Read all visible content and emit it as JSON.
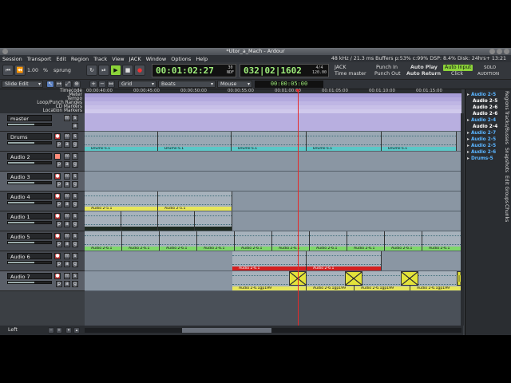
{
  "window": {
    "title": "*Utor_a_Mach - Ardour"
  },
  "menu": {
    "items": [
      "Session",
      "Transport",
      "Edit",
      "Region",
      "Track",
      "View",
      "JACK",
      "Window",
      "Options",
      "Help"
    ],
    "status": "48 kHz / 21.3 ms  Buffers p:53% c:99%  DSP: 8.4%  Disk: 24hrs+  13:21"
  },
  "transport": {
    "shuttle_speed": "1.00",
    "shuttle_unit": "%",
    "shuttle_mode": "sprung",
    "primary_clock": "00:01:02:27",
    "primary_clock_fps": "30",
    "primary_clock_mode": "NDF",
    "secondary_clock": "032|02|1602",
    "secondary_clock_meter": "4/4",
    "secondary_clock_tempo": "120.00",
    "sync_source": "JACK",
    "time_master": "Time master",
    "punch_in": "Punch In",
    "punch_out": "Punch Out",
    "auto_play": "Auto Play",
    "auto_return": "Auto Return",
    "auto_input": "Auto Input",
    "click": "Click",
    "solo": "SOLO",
    "audition": "AUDITION"
  },
  "editbar": {
    "edit_mode": "Slide Edit",
    "snap_type": "Grid",
    "snap_unit": "Beats",
    "edit_point": "Mouse",
    "nudge_clock": "00:00:05:00"
  },
  "rulers": {
    "labels": [
      "Timecode",
      "Meter",
      "Tempo",
      "Loop/Punch Ranges",
      "CD Markers",
      "Location Markers"
    ],
    "timecode_ticks": [
      "00:00:40:00",
      "00:00:45:00",
      "00:00:50:00",
      "00:00:55:00",
      "00:01:00:00",
      "00:01:05:00",
      "00:01:10:00",
      "00:01:15:00"
    ]
  },
  "tracks": [
    {
      "name": "master",
      "type": "master"
    },
    {
      "name": "Drums",
      "type": "audio"
    },
    {
      "name": "Audio 2",
      "type": "audio"
    },
    {
      "name": "Audio 3",
      "type": "audio"
    },
    {
      "name": "Audio 4",
      "type": "audio"
    },
    {
      "name": "Audio 1",
      "type": "audio"
    },
    {
      "name": "Audio 5",
      "type": "audio"
    },
    {
      "name": "Audio 6",
      "type": "audio"
    },
    {
      "name": "Audio 7",
      "type": "audio"
    }
  ],
  "track_buttons": {
    "mute": "m",
    "solo": "s",
    "playlist": "p",
    "automation": "a",
    "group": "g"
  },
  "regions": {
    "drums": [
      "Drums-5.1",
      "Drums-5.1",
      "Drums-5.1",
      "Drums-5.1",
      "Drums-5.1"
    ],
    "audio4": [
      "Audio 2-5.1",
      "Audio 2-5.1"
    ],
    "audio5": [
      "Audio 2-6.1",
      "Audio 2-6.1",
      "Audio 2-6.1",
      "Audio 2-6.1",
      "Audio 2-6.1",
      "Audio 2-6.1",
      "Audio 2-6.1",
      "Audio 2-6.1",
      "Audio 2-6.1",
      "Audio 2-6.1"
    ],
    "audio6": [
      "Audio 2-6.1",
      "Audio 2-6.1"
    ],
    "audio7": [
      "Audio 2-6.1gp199",
      "Audio 2-6.1gp199",
      "Audio 2-6.1gp199",
      "Audio 2-6.1gp199"
    ]
  },
  "bottom": {
    "left_label": "Left"
  },
  "region_list": [
    "Audio 2-5",
    "Audio 2-5",
    "Audio 2-6",
    "Audio 2-6",
    "Audio 2-4",
    "Audio 2-4",
    "Audio 2-7",
    "Audio 2-5",
    "Audio 2-5",
    "Audio 2-6",
    "Drums-5"
  ],
  "side_tabs": [
    "Regions",
    "Tracks/Busses",
    "Snapshots",
    "Edit Groups",
    "Chunks"
  ],
  "colors": {
    "accent_green": "#8cd43a",
    "playhead": "#e52a2a",
    "region_name_green": "#7fd86a",
    "region_name_yellow": "#e7e65a"
  }
}
